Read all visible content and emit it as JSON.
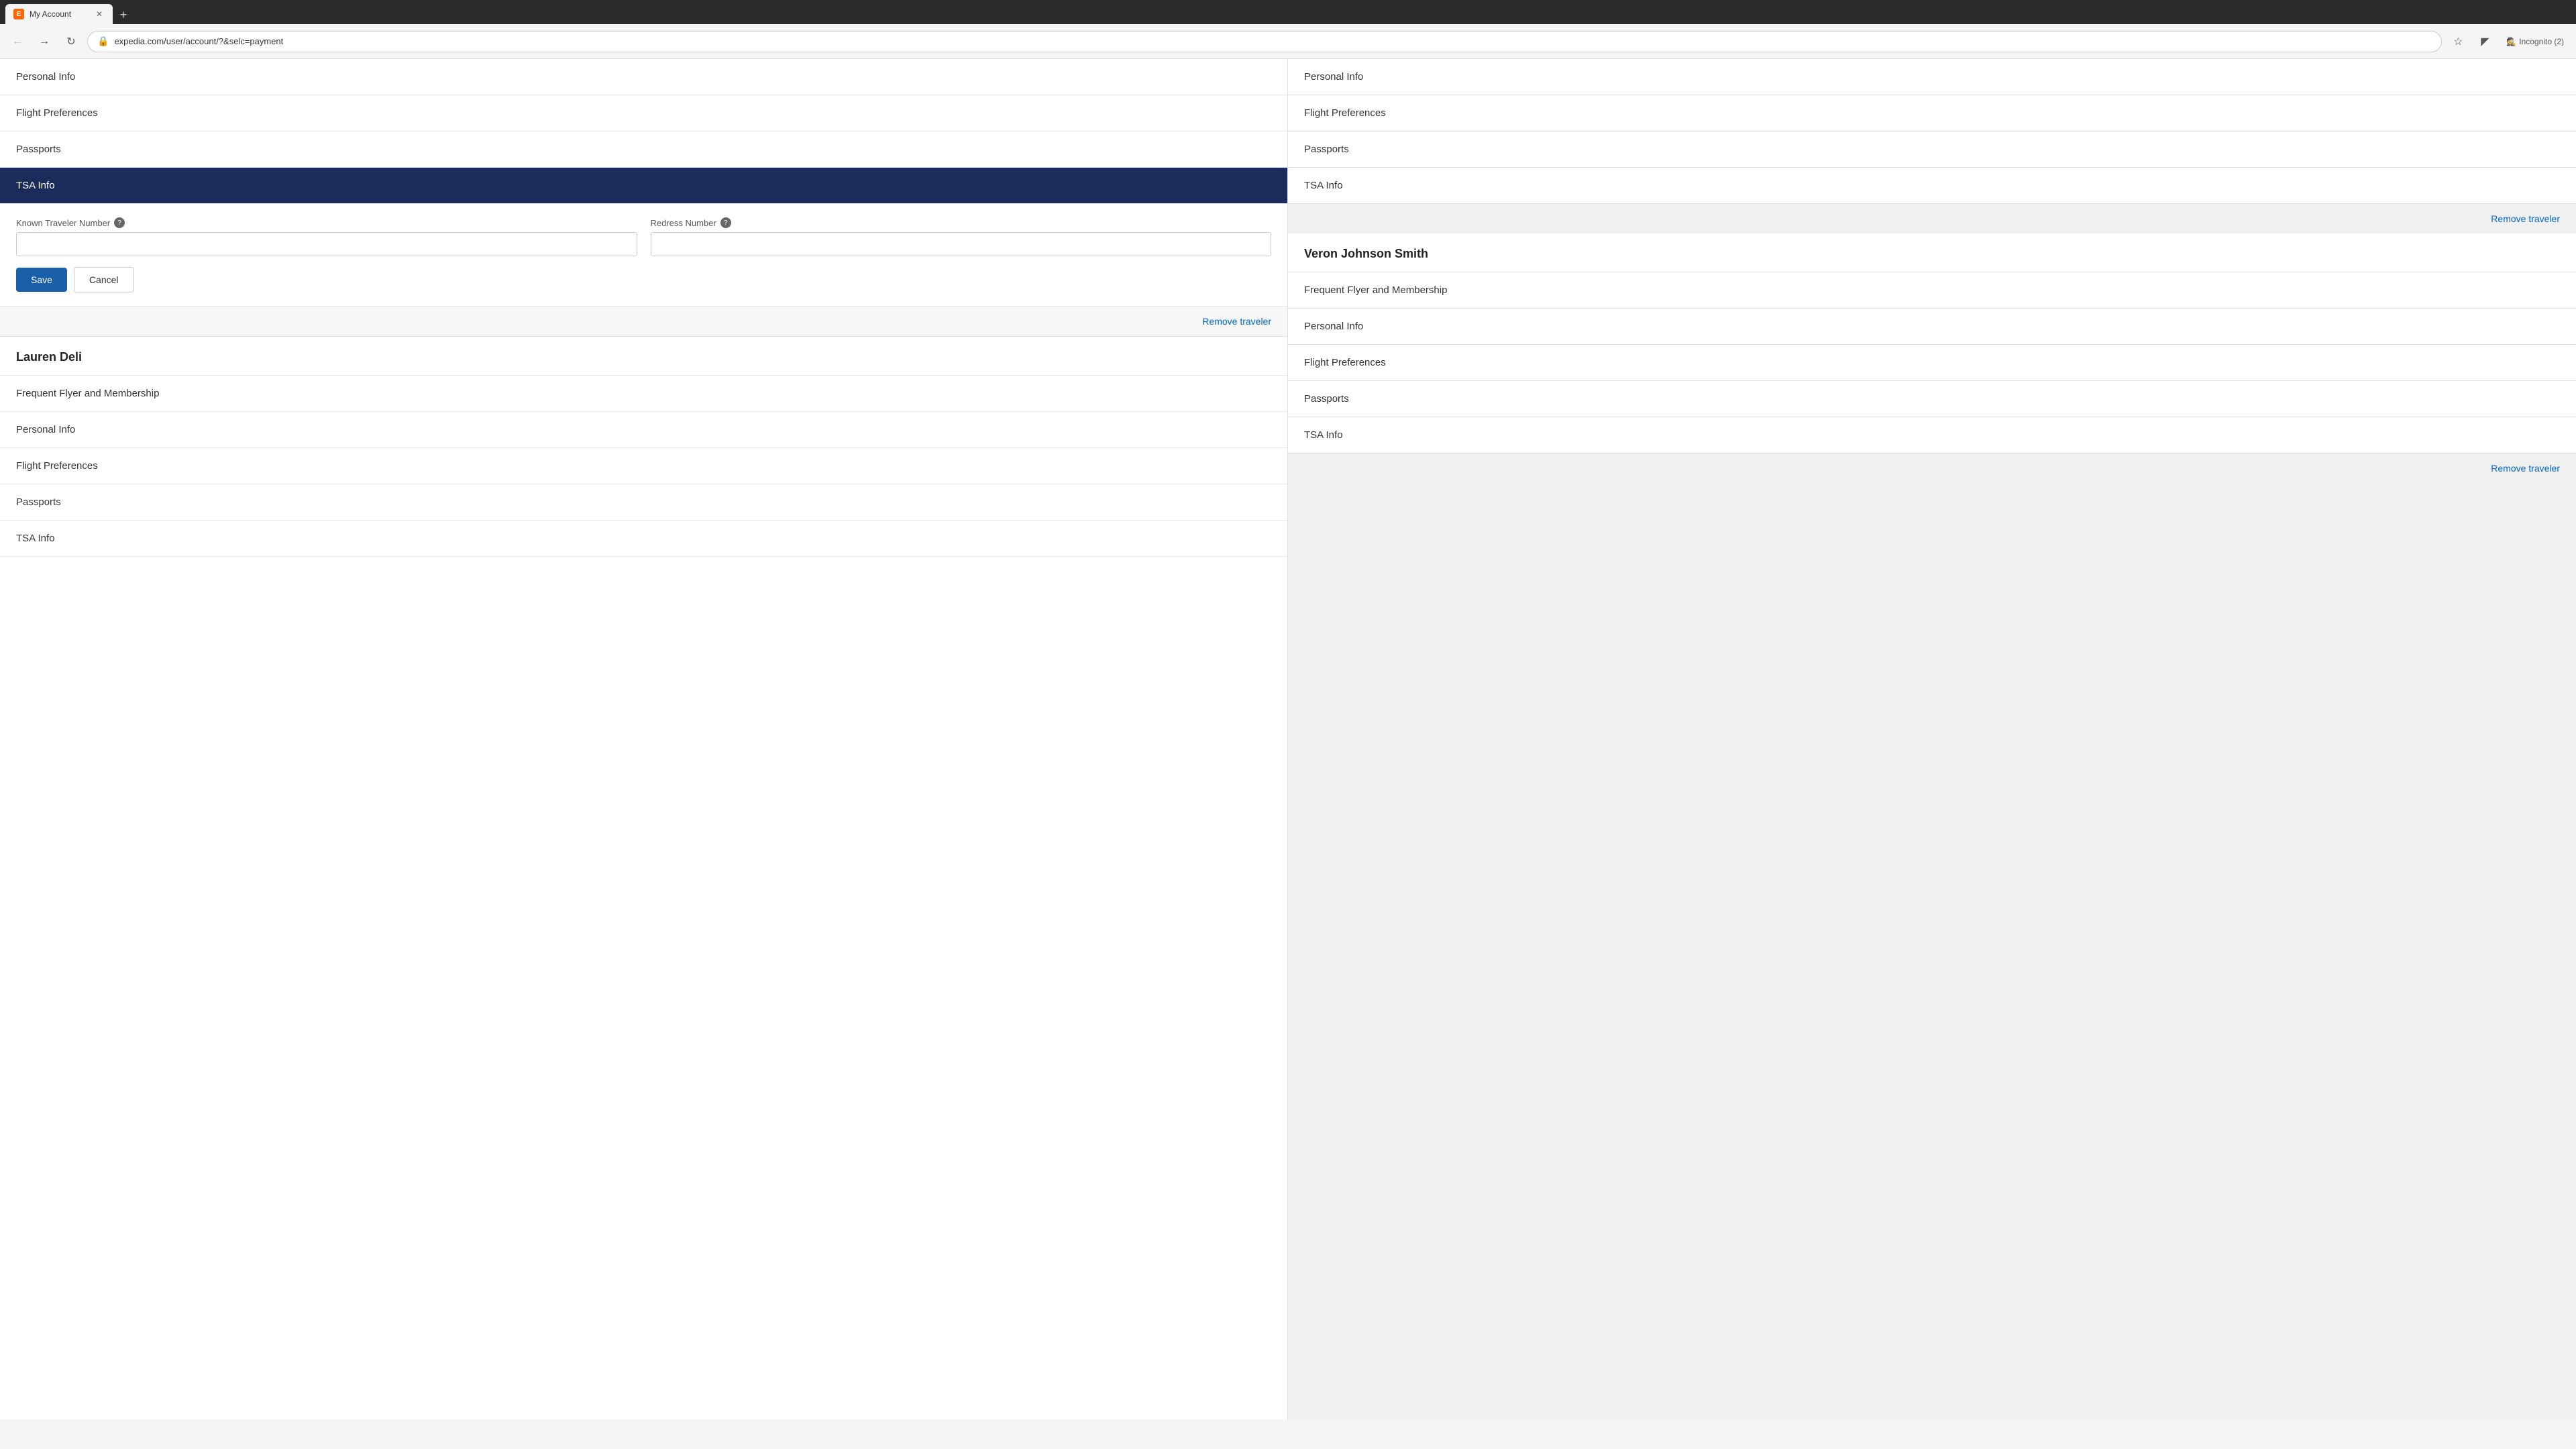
{
  "browser": {
    "tab_title": "My Account",
    "tab_favicon": "E",
    "address": "expedia.com/user/account/?&selc=payment",
    "incognito_label": "Incognito (2)"
  },
  "left_column": {
    "traveler_sections": [
      {
        "nav_items": [
          {
            "label": "Personal Info",
            "active": false
          },
          {
            "label": "Flight Preferences",
            "active": false
          },
          {
            "label": "Passports",
            "active": false
          },
          {
            "label": "TSA Info",
            "active": true
          }
        ],
        "tsa_form": {
          "known_traveler_label": "Known Traveler Number",
          "redress_label": "Redress Number",
          "known_traveler_placeholder": "",
          "redress_placeholder": "",
          "save_label": "Save",
          "cancel_label": "Cancel",
          "help_icon_symbol": "?"
        },
        "remove_traveler_label": "Remove traveler"
      },
      {
        "traveler_name": "Lauren Deli",
        "nav_items": [
          {
            "label": "Frequent Flyer and Membership",
            "active": false
          },
          {
            "label": "Personal Info",
            "active": false
          },
          {
            "label": "Flight Preferences",
            "active": false
          },
          {
            "label": "Passports",
            "active": false
          },
          {
            "label": "TSA Info",
            "active": false
          }
        ]
      }
    ]
  },
  "right_column": {
    "traveler_sections": [
      {
        "nav_items": [
          {
            "label": "Personal Info"
          },
          {
            "label": "Flight Preferences"
          },
          {
            "label": "Passports"
          },
          {
            "label": "TSA Info"
          }
        ],
        "remove_traveler_label": "Remove traveler"
      },
      {
        "traveler_name": "Veron Johnson Smith",
        "nav_items": [
          {
            "label": "Frequent Flyer and Membership"
          },
          {
            "label": "Personal Info"
          },
          {
            "label": "Flight Preferences"
          },
          {
            "label": "Passports"
          },
          {
            "label": "TSA Info"
          }
        ],
        "remove_traveler_label": "Remove traveler"
      }
    ]
  }
}
